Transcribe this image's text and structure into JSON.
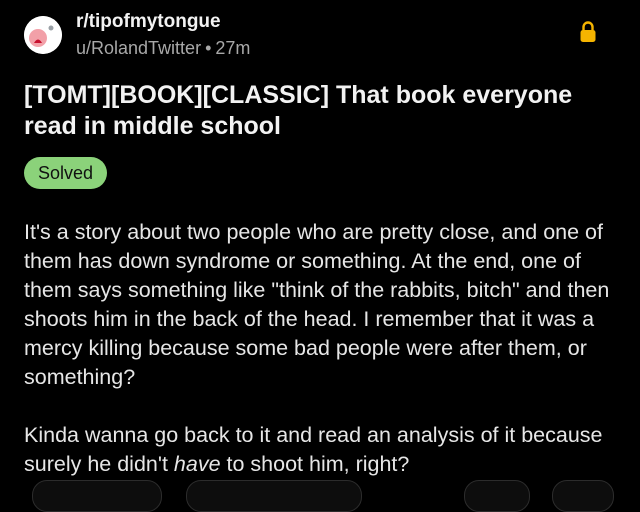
{
  "post": {
    "subreddit": "r/tipofmytongue",
    "author": "u/RolandTwitter",
    "separator": "•",
    "age": "27m",
    "title": "[TOMT][BOOK][CLASSIC] That book everyone read in middle school",
    "flair": "Solved",
    "flair_color": "#8bd27a",
    "paragraph_1": "It's a story about two people who are pretty close, and one of them has down syndrome or something. At the end, one of them says something like \"think of the rabbits, bitch\" and then shoots him in the back of the head. I remember that it was a mercy killing because some bad people were after them, or something?",
    "paragraph_2_before": "Kinda wanna go back to it and read an analysis of  it because surely he didn't ",
    "paragraph_2_emphasis": "have",
    "paragraph_2_after": " to shoot him, right?"
  },
  "icons": {
    "avatar": "subreddit-avatar-icon",
    "lock": "lock-icon"
  },
  "colors": {
    "background": "#000000",
    "lock": "#f5b400"
  }
}
